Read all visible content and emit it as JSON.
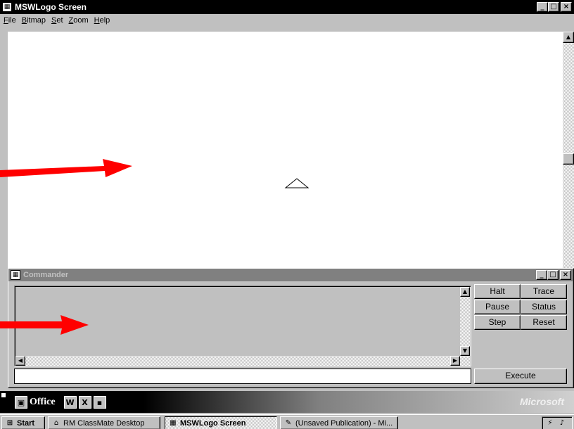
{
  "main_window": {
    "title": "MSWLogo Screen",
    "menu": [
      {
        "label_u": "F",
        "label_rest": "ile"
      },
      {
        "label_u": "B",
        "label_rest": "itmap"
      },
      {
        "label_u": "S",
        "label_rest": "et"
      },
      {
        "label_u": "Z",
        "label_rest": "oom"
      },
      {
        "label_u": "H",
        "label_rest": "elp"
      }
    ],
    "window_buttons": {
      "minimize": "_",
      "maximize": "□",
      "close": "×"
    }
  },
  "commander": {
    "title": "Commander",
    "buttons": {
      "halt": "Halt",
      "trace": "Trace",
      "pause": "Pause",
      "status": "Status",
      "step": "Step",
      "reset": "Reset",
      "execute": "Execute"
    },
    "input_value": ""
  },
  "office_bar": {
    "label": "Office",
    "brand": "Microsoft"
  },
  "taskbar": {
    "start": "Start",
    "items": [
      {
        "label": "RM ClassMate Desktop",
        "pressed": false
      },
      {
        "label": "MSWLogo Screen",
        "pressed": true
      },
      {
        "label": "(Unsaved Publication) - Mi...",
        "pressed": false
      }
    ]
  },
  "colors": {
    "arrow": "#ff0000",
    "titlebar_active": "#000000",
    "titlebar_inactive": "#808080"
  }
}
